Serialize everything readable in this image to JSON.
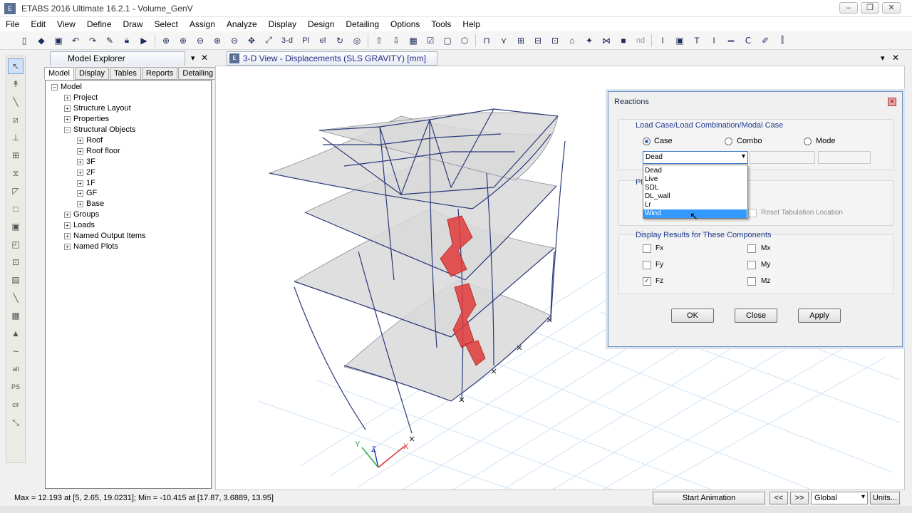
{
  "app": {
    "title": "ETABS 2016 Ultimate 16.2.1 - Volume_GenV",
    "icon": "etabs-app-icon",
    "window_buttons": [
      "minimize",
      "maximize",
      "close"
    ]
  },
  "menu": [
    "File",
    "Edit",
    "View",
    "Define",
    "Draw",
    "Select",
    "Assign",
    "Analyze",
    "Display",
    "Design",
    "Detailing",
    "Options",
    "Tools",
    "Help"
  ],
  "toolbar": {
    "text_buttons": {
      "view3d": "3-d",
      "plan": "Pl",
      "elev": "el",
      "nd": "nd"
    }
  },
  "left_tools": {
    "text_buttons": {
      "all": "all",
      "ps": "PS",
      "clr": "clr"
    }
  },
  "explorer": {
    "title": "Model Explorer",
    "pin": "▾",
    "close": "✕",
    "tabs": [
      "Model",
      "Display",
      "Tables",
      "Reports",
      "Detailing"
    ],
    "active_tab": "Model",
    "tree": {
      "root": "Model",
      "items": [
        "Project",
        "Structure Layout",
        "Properties",
        "Structural Objects"
      ],
      "structural_objects": [
        "Roof",
        "Roof floor",
        "3F",
        "2F",
        "1F",
        "GF",
        "Base"
      ],
      "items_after": [
        "Groups",
        "Loads",
        "Named Output Items",
        "Named Plots"
      ]
    }
  },
  "view": {
    "tab_title": "3-D View  - Displacements (SLS GRAVITY)  [mm]",
    "pin": "▾",
    "close": "✕",
    "axes": {
      "x": "X",
      "y": "Y",
      "z": "Z"
    }
  },
  "dialog": {
    "title": "Reactions",
    "close": "✕",
    "group1_label": "Load Case/Load Combination/Modal Case",
    "radios": {
      "case": "Case",
      "combo": "Combo",
      "mode": "Mode"
    },
    "selected_radio": "Case",
    "case_value": "Dead",
    "dropdown_arrow": "▾",
    "dropdown_options": [
      "Dead",
      "Live",
      "SDL",
      "DL_wall",
      "Lr",
      "Wind"
    ],
    "highlighted_option": "Wind",
    "group2_label_partial": "Pl",
    "reset_label": "Reset Tabulation Location",
    "group3_label": "Display Results for These Components",
    "components": {
      "fx": "Fx",
      "fy": "Fy",
      "fz": "Fz",
      "mx": "Mx",
      "my": "My",
      "mz": "Mz"
    },
    "checked": {
      "fx": false,
      "fy": false,
      "fz": true,
      "mx": false,
      "my": false,
      "mz": false
    },
    "check_mark": "✓",
    "buttons": {
      "ok": "OK",
      "close": "Close",
      "apply": "Apply"
    }
  },
  "status": {
    "text": "Max = 12.193 at [5, 2.65, 19.0231];  Min = -10.415 at [17.87, 3.6889, 13.95]",
    "animation_button": "Start Animation",
    "prev": "<<",
    "next": ">>",
    "coord_system": "Global",
    "coord_arrow": "▾",
    "units_button": "Units..."
  },
  "colors": {
    "frame_lines": "#2b3a7a",
    "shell_fill": "#d9d9d9",
    "wall_red": "#e03a3a",
    "grid_lines": "#cfe3f5",
    "dropdown_highlight": "#3399ff"
  }
}
